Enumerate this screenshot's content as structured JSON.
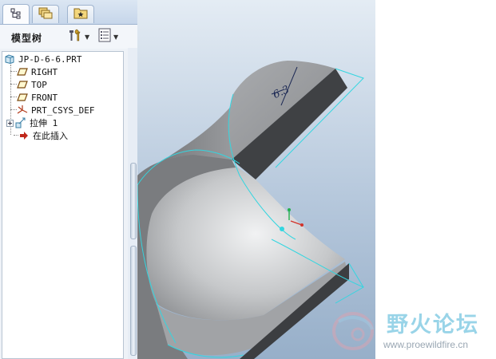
{
  "colors": {
    "viewport_top": "#e4ecf4",
    "viewport_bottom": "#97afc9",
    "edge_highlight": "#33d6e0",
    "part_face": "#8e9093",
    "part_dark": "#3c3e41",
    "watermark": "#8fd0e6"
  },
  "tabs": [
    {
      "name": "model-tree-tab",
      "icon": "tree-icon"
    },
    {
      "name": "folder-browser-tab",
      "icon": "folders-icon"
    },
    {
      "name": "favorites-tab",
      "icon": "star-folder-icon"
    }
  ],
  "toolbar": {
    "title": "模型树",
    "settings_icon": "tools-icon",
    "show_icon": "list-icon"
  },
  "tree": {
    "root": "JP-D-6-6.PRT",
    "items": [
      {
        "label": "RIGHT",
        "icon": "datum-plane-icon"
      },
      {
        "label": "TOP",
        "icon": "datum-plane-icon"
      },
      {
        "label": "FRONT",
        "icon": "datum-plane-icon"
      },
      {
        "label": "PRT_CSYS_DEF",
        "icon": "csys-icon"
      },
      {
        "label": "拉伸 1",
        "icon": "extrude-icon"
      },
      {
        "label": "在此插入",
        "icon": "insert-here-icon"
      }
    ]
  },
  "viewport": {
    "sketch_label": "6.3"
  },
  "watermark": {
    "title": "野火论坛",
    "url": "www.proewildfire.cn"
  }
}
